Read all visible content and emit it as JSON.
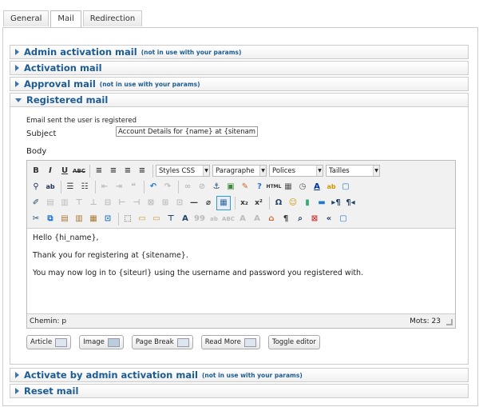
{
  "tabs": [
    {
      "label": "General"
    },
    {
      "label": "Mail"
    },
    {
      "label": "Redirection"
    }
  ],
  "panels": {
    "admin_activation": {
      "title": "Admin activation mail",
      "note": "(not in use with your params)"
    },
    "activation": {
      "title": "Activation mail",
      "note": ""
    },
    "approval": {
      "title": "Approval mail",
      "note": "(not in use with your params)"
    },
    "registered": {
      "title": "Registered mail",
      "note": ""
    },
    "activate_by_admin": {
      "title": "Activate by admin activation mail",
      "note": "(not in use with your params)"
    },
    "reset": {
      "title": "Reset mail",
      "note": ""
    }
  },
  "registered_form": {
    "description": "Email sent the user is registered",
    "subject_label": "Subject",
    "subject_value": "Account Details for {name} at {sitename}",
    "body_label": "Body"
  },
  "toolbar": {
    "styles_select": "Styles CSS",
    "format_select": "Paragraphe",
    "font_select": "Polices",
    "size_select": "Tailles"
  },
  "editor_content": {
    "line1": "Hello {hi_name},",
    "line2": "Thank you for registering at {sitename}.",
    "line3": "You may now log in to {siteurl} using the username and password you registered with."
  },
  "status": {
    "path": "Chemin: p",
    "words": "Mots: 23"
  },
  "editor_buttons": {
    "article": "Article",
    "image": "Image",
    "page_break": "Page Break",
    "read_more": "Read More",
    "toggle": "Toggle editor"
  }
}
